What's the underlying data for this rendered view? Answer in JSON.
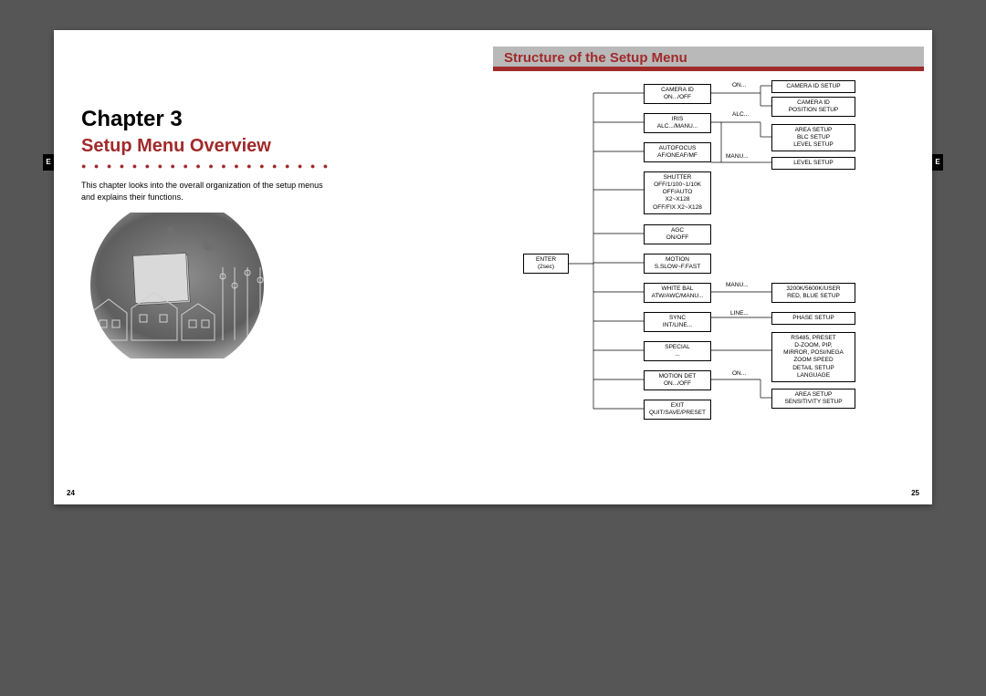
{
  "left": {
    "chapter": "Chapter 3",
    "subtitle": "Setup Menu Overview",
    "dots": "● ● ● ● ● ● ● ● ● ● ● ● ● ● ● ● ● ● ● ● ● ● ● ● ● ● ● ● ● ● ● ● ● ●",
    "intro": "This chapter looks into the overall organization of the setup menus and explains their functions.",
    "tab": "E",
    "pagenum": "24"
  },
  "right": {
    "title": "Structure of the Setup Menu",
    "tab": "E",
    "pagenum": "25"
  },
  "diagram": {
    "root": "ENTER\n(2sec)",
    "col2": {
      "camera_id": "CAMERA ID\nON.../OFF",
      "iris": "IRIS\nALC.../MANU...",
      "autofocus": "AUTOFOCUS\nAF/ONEAF/MF",
      "shutter": "SHUTTER\nOFF/1/100~1/10K\nOFF/AUTO\nX2~X128\nOFF/FIX X2~X128",
      "agc": "AGC\nON/OFF",
      "motion": "MOTION\nS.SLOW~F.FAST",
      "whitebal": "WHITE BAL\nATW/AWC/MANU...",
      "sync": "SYNC\nINT/LINE...",
      "special": "SPECIAL\n...",
      "motiondet": "MOTION DET\nON.../OFF",
      "exit": "EXIT\nQUIT/SAVE/PRESET"
    },
    "labels": {
      "on1": "ON...",
      "alc": "ALC...",
      "manu1": "MANU...",
      "manu2": "MANU...",
      "line": "LINE...",
      "on2": "ON..."
    },
    "col3": {
      "cam_id_setup": "CAMERA ID SETUP",
      "cam_pos": "CAMERA ID\nPOSITION SETUP",
      "area_blc": "AREA SETUP\nBLC SETUP\nLEVEL SETUP",
      "level": "LEVEL SETUP",
      "wb_user": "3200K/5600K/USER\nRED, BLUE SETUP",
      "phase": "PHASE SETUP",
      "special_out": "RS485, PRESET\nD-ZOOM, PIP,\nMIRROR, POSI/NEGA\nZOOM SPEED\nDETAIL SETUP\nLANGUAGE",
      "md_out": "AREA SETUP\nSENSITIVITY SETUP"
    }
  }
}
